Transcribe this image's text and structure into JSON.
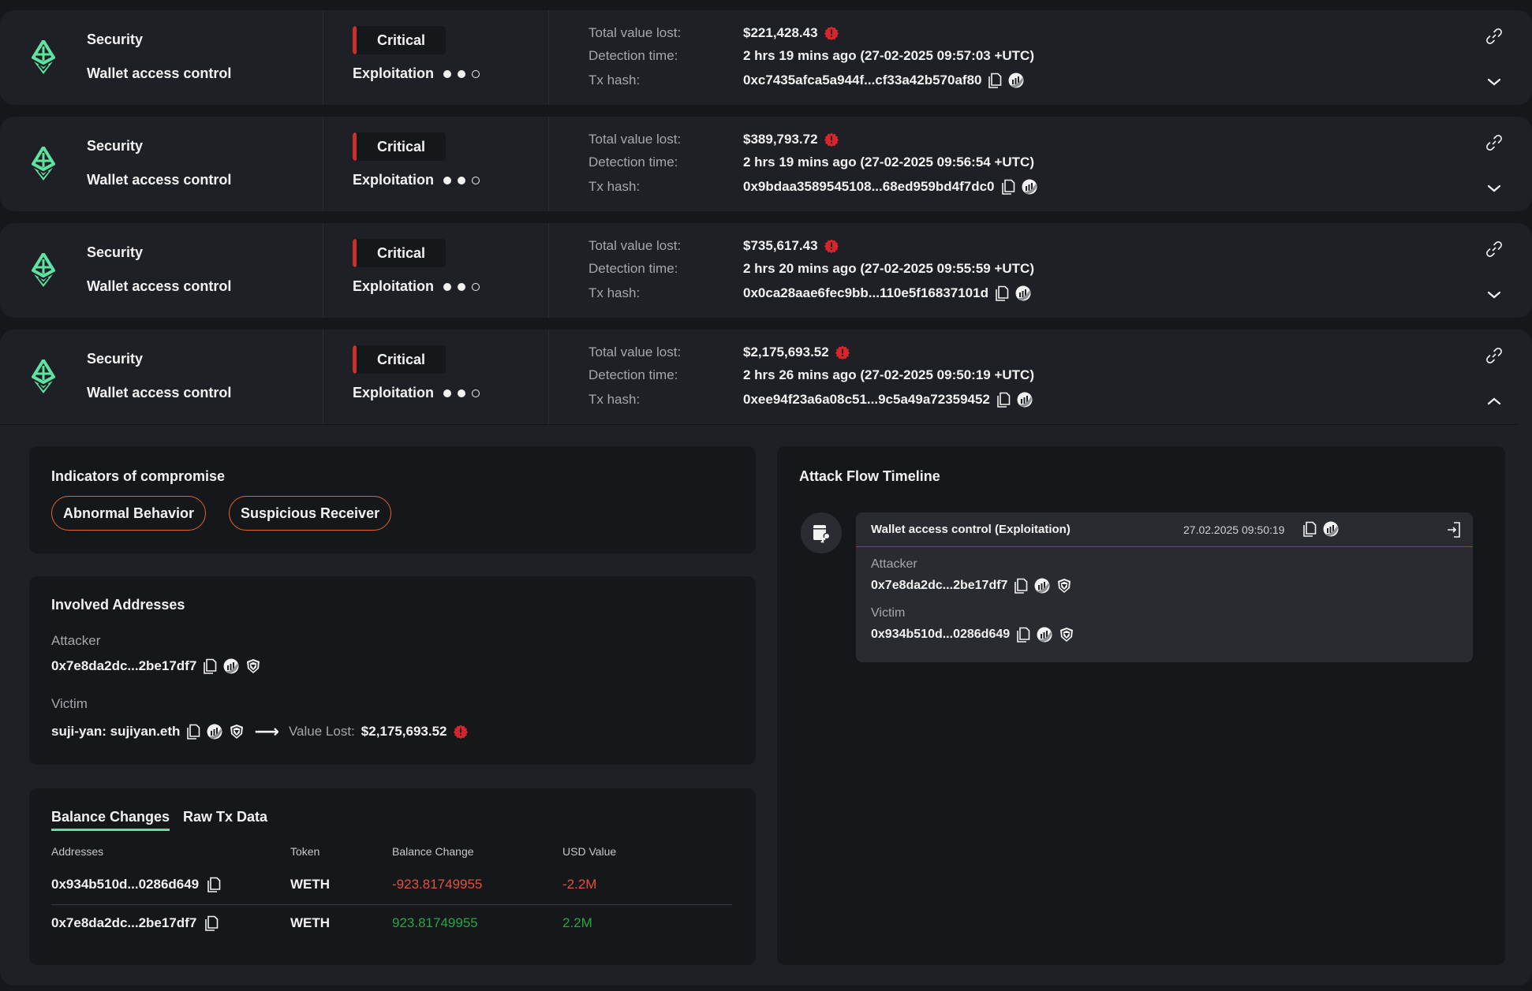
{
  "colors": {
    "background": "#16171b",
    "card": "#1f2025",
    "accent_green": "#5ee3a1",
    "critical_red": "#c9302c",
    "pill_orange": "#e0662a",
    "negative": "#e0513e",
    "positive": "#25a744"
  },
  "labels": {
    "total_value_lost": "Total value lost:",
    "detection_time": "Detection time:",
    "tx_hash": "Tx hash:"
  },
  "incidents": [
    {
      "chain_icon": "ethereum-icon",
      "category": "Security",
      "subcategory": "Wallet access control",
      "severity": "Critical",
      "stage": "Exploitation",
      "stage_progress": "2 of 3",
      "total_value_lost": "$221,428.43",
      "detection_time": "2 hrs 19 mins ago (27-02-2025 09:57:03 +UTC)",
      "tx_hash": "0xc7435afca5a944f...cf33a42b570af80",
      "expanded": false
    },
    {
      "chain_icon": "ethereum-icon",
      "category": "Security",
      "subcategory": "Wallet access control",
      "severity": "Critical",
      "stage": "Exploitation",
      "stage_progress": "2 of 3",
      "total_value_lost": "$389,793.72",
      "detection_time": "2 hrs 19 mins ago (27-02-2025 09:56:54 +UTC)",
      "tx_hash": "0x9bdaa3589545108...68ed959bd4f7dc0",
      "expanded": false
    },
    {
      "chain_icon": "ethereum-icon",
      "category": "Security",
      "subcategory": "Wallet access control",
      "severity": "Critical",
      "stage": "Exploitation",
      "stage_progress": "2 of 3",
      "total_value_lost": "$735,617.43",
      "detection_time": "2 hrs 20 mins ago (27-02-2025 09:55:59 +UTC)",
      "tx_hash": "0x0ca28aae6fec9bb...110e5f16837101d",
      "expanded": false
    },
    {
      "chain_icon": "ethereum-icon",
      "category": "Security",
      "subcategory": "Wallet access control",
      "severity": "Critical",
      "stage": "Exploitation",
      "stage_progress": "2 of 3",
      "total_value_lost": "$2,175,693.52",
      "detection_time": "2 hrs 26 mins ago (27-02-2025 09:50:19 +UTC)",
      "tx_hash": "0xee94f23a6a08c51...9c5a49a72359452",
      "expanded": true
    }
  ],
  "details": {
    "indicators": {
      "title": "Indicators of compromise",
      "items": [
        "Abnormal Behavior",
        "Suspicious Receiver"
      ]
    },
    "involved": {
      "title": "Involved Addresses",
      "attacker_label": "Attacker",
      "attacker": "0x7e8da2dc...2be17df7",
      "victim_label": "Victim",
      "victim": "suji-yan: sujiyan.eth",
      "value_lost_label": "Value Lost:",
      "value_lost": "$2,175,693.52"
    },
    "balance": {
      "tabs": [
        "Balance Changes",
        "Raw Tx Data"
      ],
      "active_tab": "Balance Changes",
      "columns": [
        "Addresses",
        "Token",
        "Balance Change",
        "USD Value"
      ],
      "rows": [
        {
          "address": "0x934b510d...0286d649",
          "token": "WETH",
          "change": "-923.81749955",
          "usd": "-2.2M",
          "direction": "negative"
        },
        {
          "address": "0x7e8da2dc...2be17df7",
          "token": "WETH",
          "change": "923.81749955",
          "usd": "2.2M",
          "direction": "positive"
        }
      ]
    },
    "timeline": {
      "title": "Attack Flow Timeline",
      "events": [
        {
          "title": "Wallet access control  (Exploitation)",
          "timestamp": "27.02.2025 09:50:19",
          "attacker_label": "Attacker",
          "attacker": "0x7e8da2dc...2be17df7",
          "victim_label": "Victim",
          "victim": "0x934b510d...0286d649"
        }
      ]
    }
  }
}
